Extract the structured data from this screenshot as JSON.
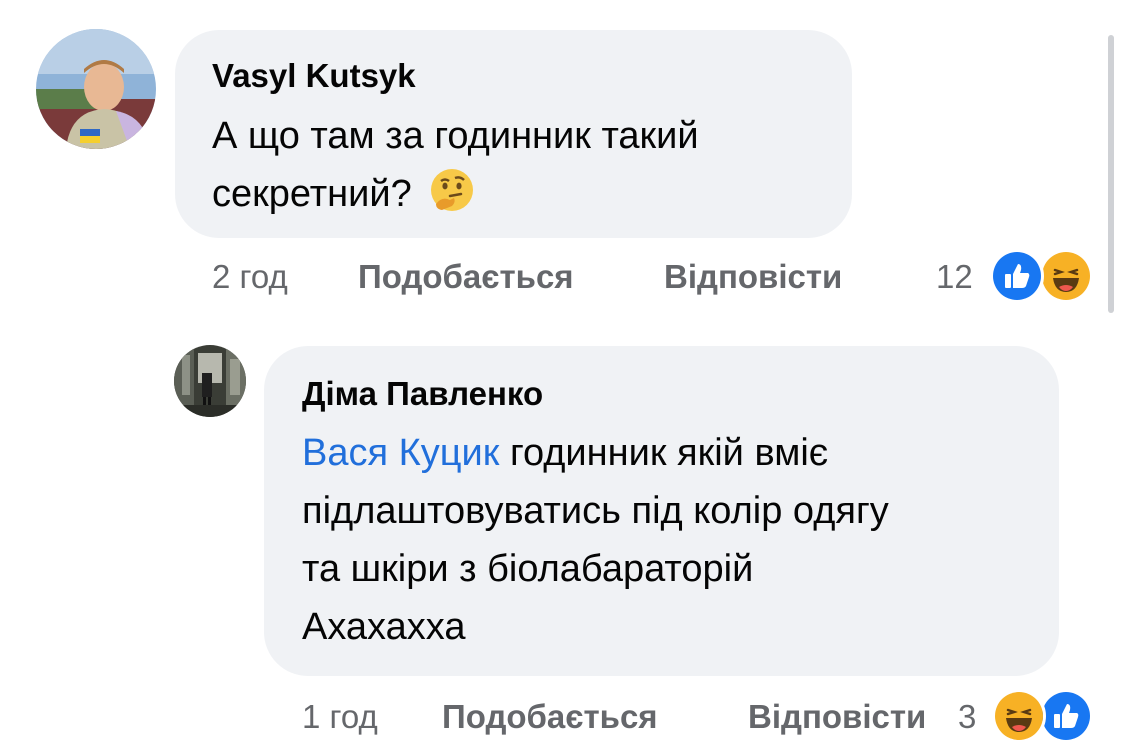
{
  "comments": [
    {
      "author": "Vasyl Kutsyk",
      "text_line1": "А що там за годинник такий",
      "text_line2": "секретний?",
      "inline_emoji": "thinking-face-emoji",
      "time": "2 год",
      "like_label": "Подобається",
      "reply_label": "Відповісти",
      "reaction_count": "12",
      "reactions": [
        "like-icon",
        "haha-icon"
      ]
    },
    {
      "author": "Діма Павленко",
      "mention": "Вася Куцик",
      "text_line1": "годинник якій вміє",
      "text_line2": "підлаштовуватись під колір одягу",
      "text_line3": "та шкіри з біолабараторій",
      "text_line4": "Ахахахха",
      "time": "1 год",
      "like_label": "Подобається",
      "reply_label": "Відповісти",
      "reaction_count": "3",
      "reactions": [
        "haha-icon",
        "like-icon"
      ]
    }
  ],
  "colors": {
    "bubble": "#f0f2f5",
    "meta": "#65676b",
    "mention": "#216fdb",
    "like_blue": "#1877f2",
    "haha_yellow": "#f7b125"
  }
}
